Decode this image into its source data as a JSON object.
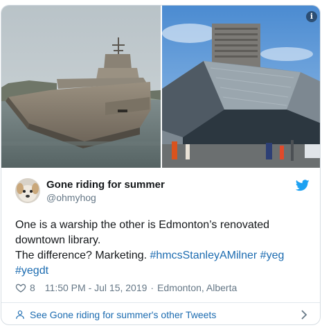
{
  "media": {
    "info_icon": "info-icon"
  },
  "tweet": {
    "display_name": "Gone riding for summer",
    "handle": "@ohmyhog",
    "body": {
      "line1": "One is a warship the other is Edmonton’s renovated",
      "line2": "downtown library.",
      "line3_prefix": "The difference? Marketing. ",
      "hashtag1": "#hmcsStanleyAMilner",
      "hashtag2": "#yeg",
      "hashtag3": "#yegdt"
    },
    "likes": "8",
    "timestamp": "11:50 PM - Jul 15, 2019",
    "separator": "·",
    "location": "Edmonton, Alberta"
  },
  "footer": {
    "link_text": "See Gone riding for summer's other Tweets"
  },
  "colors": {
    "link": "#1b6bb0",
    "twitter_blue": "#1da1f2",
    "muted": "#657786",
    "border": "#d6dde3"
  }
}
